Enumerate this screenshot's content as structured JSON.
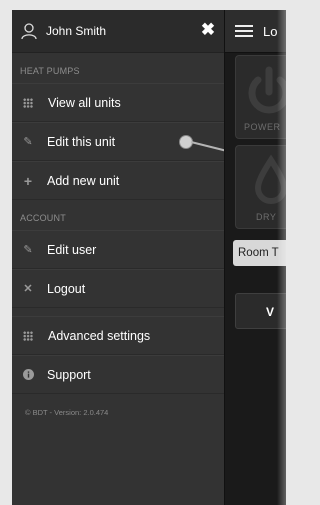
{
  "sidebar": {
    "username": "John Smith",
    "close_icon": "close-icon",
    "sections": {
      "heat_pumps": "HEAT PUMPS",
      "account": "ACCOUNT"
    },
    "items": [
      {
        "label": "View all units",
        "icon": "grid-icon"
      },
      {
        "label": "Edit this unit",
        "icon": "pencil-icon"
      },
      {
        "label": "Add new unit",
        "icon": "plus-icon"
      },
      {
        "label": "Edit user",
        "icon": "pencil-icon"
      },
      {
        "label": "Logout",
        "icon": "x-icon"
      },
      {
        "label": "Advanced settings",
        "icon": "grid-icon"
      },
      {
        "label": "Support",
        "icon": "info-icon"
      }
    ],
    "version": "© BDT - Version: 2.0.474"
  },
  "main": {
    "title_partial": "Lo",
    "tiles": [
      {
        "label": "POWER",
        "icon": "power-icon"
      },
      {
        "label": "DRY",
        "icon": "drop-icon"
      }
    ],
    "room_button": "Room T",
    "dark_button": "V"
  },
  "colors": {
    "sidebar_bg": "#333333",
    "header_bg": "#2b2b2b",
    "section_text": "#8d8d8d"
  }
}
